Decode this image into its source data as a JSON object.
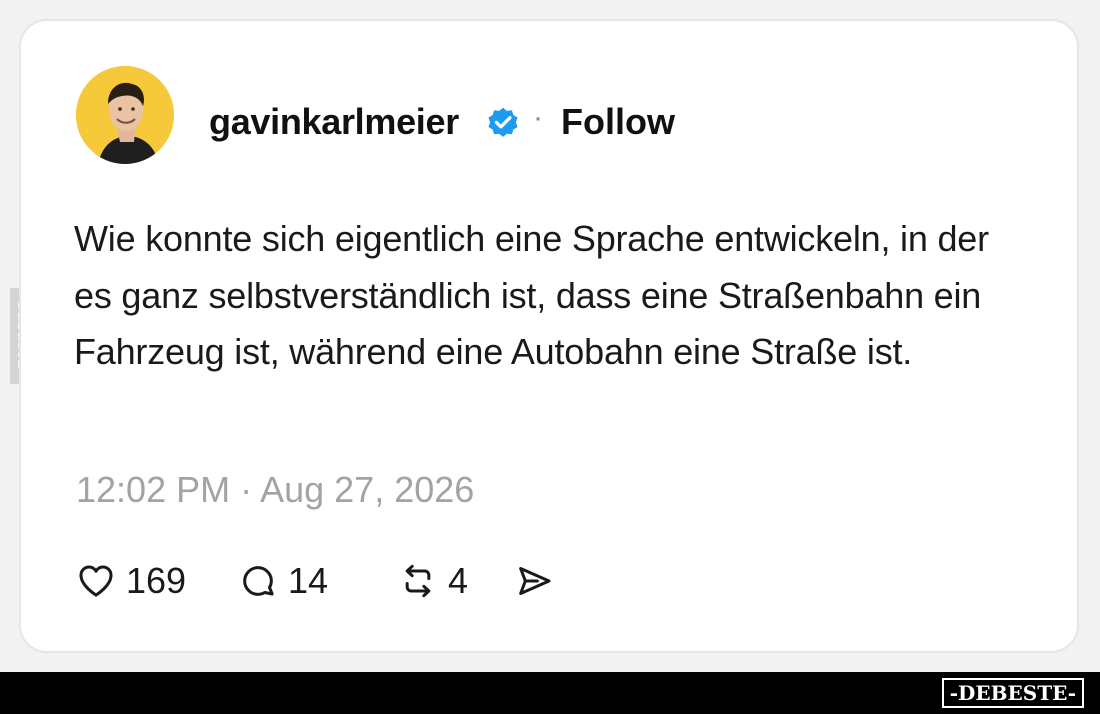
{
  "post": {
    "username": "gavinkarlmeier",
    "separator": "·",
    "follow_label": "Follow",
    "text": "Wie konnte sich eigentlich eine Sprache entwickeln, in der es ganz selbstverständlich ist, dass eine Straßenbahn ein Fahrzeug ist, während eine Autobahn eine Straße ist.",
    "timestamp": "12:02 PM · Aug 27, 2026"
  },
  "actions": {
    "likes": "169",
    "replies": "14",
    "reposts": "4"
  },
  "icons": {
    "verified": "verified-badge-icon",
    "like": "heart-icon",
    "reply": "speech-bubble-icon",
    "repost": "repost-icon",
    "share": "send-icon"
  },
  "watermark": {
    "side": "DEBESTE",
    "logo": "-DEBESTE-"
  },
  "colors": {
    "card_bg": "#ffffff",
    "page_bg": "#f2f2f2",
    "verified_blue": "#1d9bf0",
    "avatar_bg": "#f6c93b",
    "timestamp": "#a3a3a3",
    "footer_bg": "#000000"
  }
}
